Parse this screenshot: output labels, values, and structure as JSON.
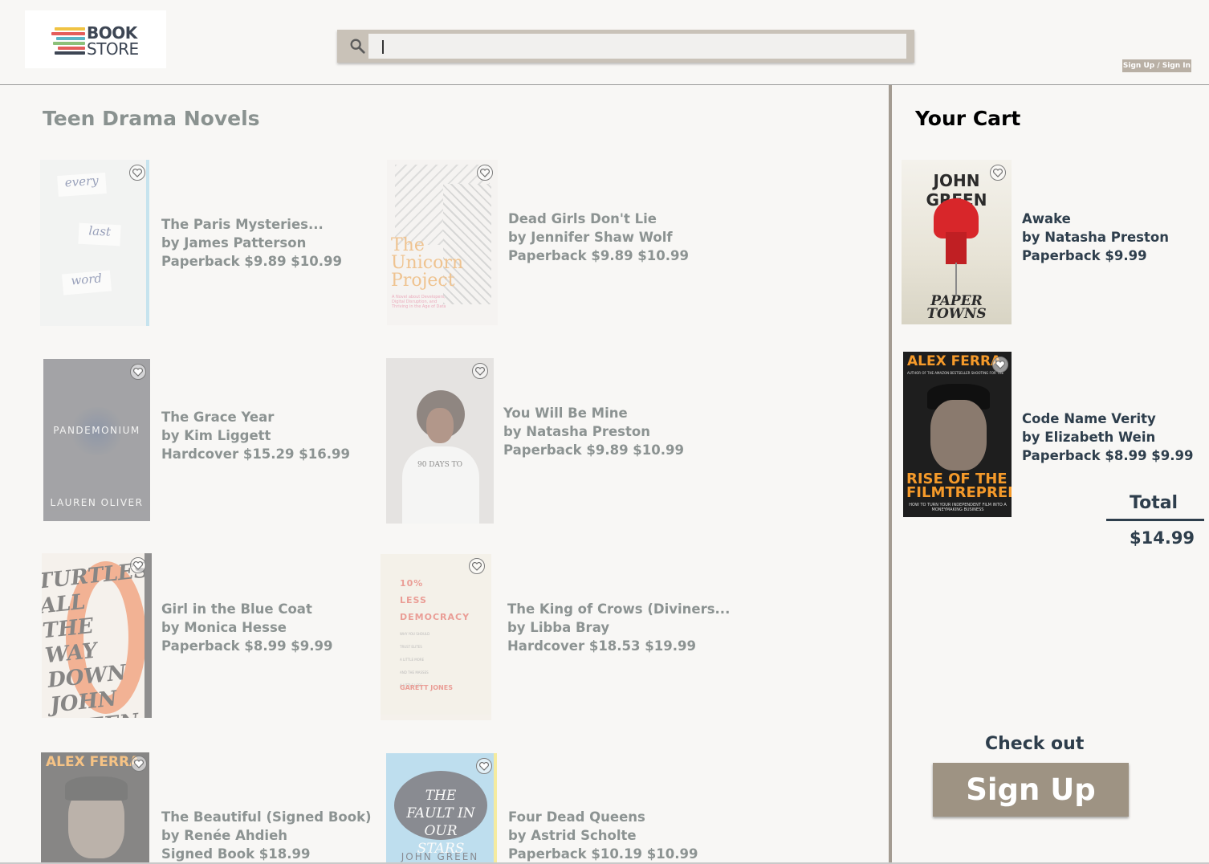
{
  "header": {
    "logo": {
      "line1": "BOOK",
      "line2": "STORE"
    },
    "search": {
      "value": "",
      "placeholder": ""
    },
    "signin_label": "Sign Up / Sign In"
  },
  "main": {
    "title": "Teen Drama Novels",
    "books": [
      {
        "title": "The Paris Mysteries...",
        "author": "by James Patterson",
        "price": "Paperback $9.89 $10.99",
        "cover": {
          "bg": "#eef0f1",
          "text": "every last word",
          "icon": "book-cover-every-last-word"
        }
      },
      {
        "title": "Dead Girls Don't Lie",
        "author": "by Jennifer Shaw Wolf",
        "price": "Paperback $9.89 $10.99",
        "cover": {
          "bg": "#f3f1ee",
          "text": "The Unicorn Project",
          "icon": "book-cover-unicorn-project"
        }
      },
      {
        "title": "The Grace Year",
        "author": "by Kim Liggett",
        "price": "Hardcover $15.29 $16.99",
        "cover": {
          "bg": "#5f6066",
          "text": "PANDEMONIUM",
          "icon": "book-cover-pandemonium"
        }
      },
      {
        "title": "You Will Be Mine",
        "author": "by Natasha Preston",
        "price": "Paperback $9.89 $10.99",
        "cover": {
          "bg": "#d6d4d2",
          "text": "90 DAYS TO",
          "icon": "book-cover-90-days"
        }
      },
      {
        "title": "Girl in the Blue Coat",
        "author": "by Monica Hesse",
        "price": "Paperback $8.99 $9.99",
        "cover": {
          "bg": "#ee7a45",
          "text": "TURTLES ALL THE WAY DOWN",
          "icon": "book-cover-turtles"
        }
      },
      {
        "title": "The King of Crows (Diviners...",
        "author": "by Libba Bray",
        "price": "Hardcover $18.53 $19.99",
        "cover": {
          "bg": "#f2ede1",
          "text": "10% LESS DEMOCRACY",
          "icon": "book-cover-less-democracy"
        }
      },
      {
        "title": "The Beautiful (Signed Book)",
        "author": "by Renée Ahdieh",
        "price": "Signed Book $18.99",
        "cover": {
          "bg": "#2b2b2b",
          "text": "ALEX FERRA",
          "icon": "book-cover-alex-ferrari"
        }
      },
      {
        "title": "Four Dead Queens",
        "author": "by Astrid Scholte",
        "price": "Paperback $10.19 $10.99",
        "cover": {
          "bg": "#8fcbea",
          "text": "THE FAULT IN OUR STARS",
          "icon": "book-cover-fault-in-our-stars"
        }
      }
    ]
  },
  "cart": {
    "title": "Your Cart",
    "items": [
      {
        "title": "Awake",
        "author": "by Natasha Preston",
        "price": "Paperback $9.99",
        "cover": {
          "top": "JOHN GREEN",
          "bottom": "PAPER TOWNS",
          "icon": "book-cover-paper-towns"
        }
      },
      {
        "title": "Code Name Verity",
        "author": "by Elizabeth Wein",
        "price": "Paperback $8.99 $9.99",
        "cover": {
          "top": "ALEX FERRA",
          "bottom": "RISE OF THE FILMTREPRENEUR",
          "icon": "book-cover-filmtrepreneur"
        }
      }
    ],
    "total_label": "Total",
    "total_value": "$14.99",
    "checkout_label": "Check out",
    "signup_label": "Sign Up"
  },
  "colors": {
    "background": "#f8f7f5",
    "search_frame": "#c9c2b8",
    "button": "#9e9383",
    "cart_text": "#2e3e4c",
    "muted_text": "#8c9392"
  }
}
